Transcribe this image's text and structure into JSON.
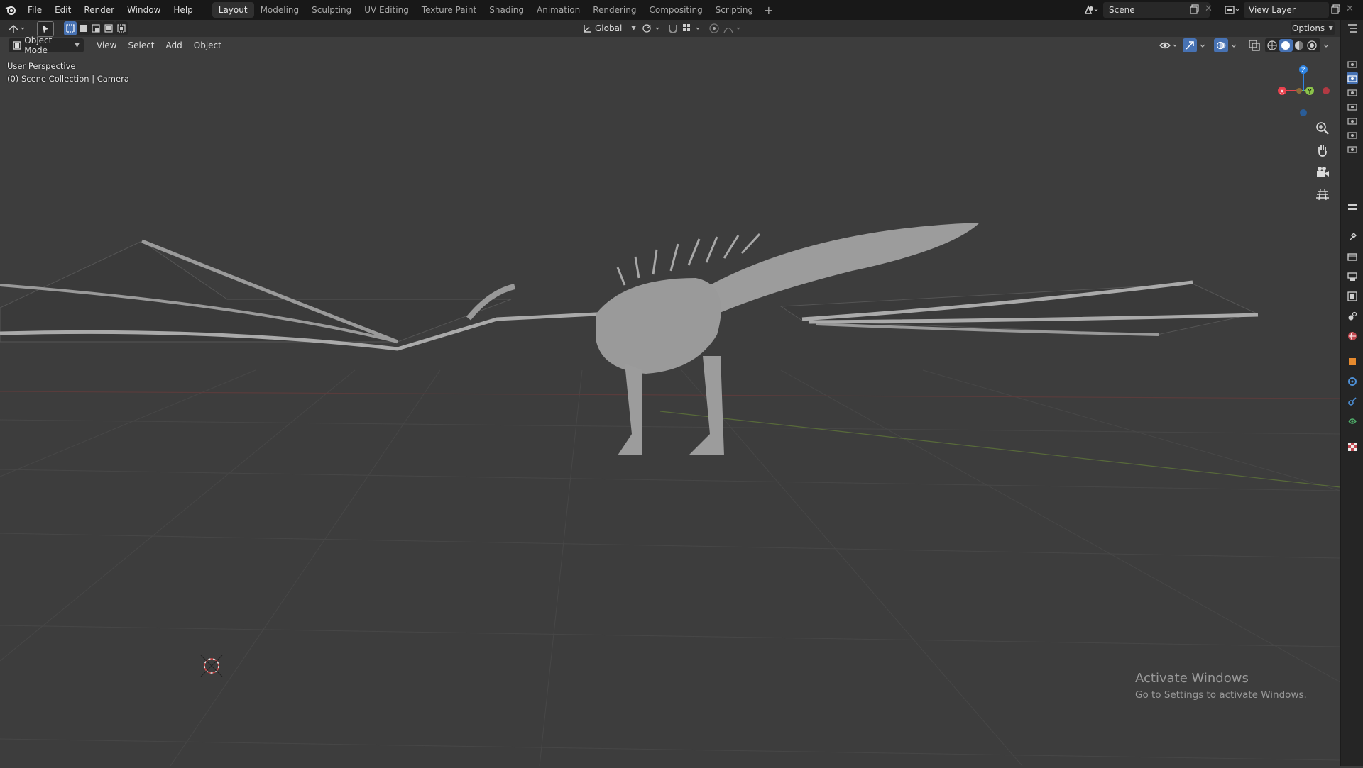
{
  "topbar": {
    "menus": [
      "File",
      "Edit",
      "Render",
      "Window",
      "Help"
    ],
    "workspace_tabs": [
      "Layout",
      "Modeling",
      "Sculpting",
      "UV Editing",
      "Texture Paint",
      "Shading",
      "Animation",
      "Rendering",
      "Compositing",
      "Scripting"
    ],
    "active_tab": "Layout",
    "add_workspace": "+",
    "scene_name": "Scene",
    "view_layer_name": "View Layer"
  },
  "toolheader": {
    "transform_orientation": "Global",
    "options_label": "Options"
  },
  "viewheader": {
    "mode": "Object Mode",
    "menus": [
      "View",
      "Select",
      "Add",
      "Object"
    ]
  },
  "viewport": {
    "perspective_label": "User Perspective",
    "collection_label": "(0) Scene Collection | Camera",
    "gizmo_axes": {
      "x": "X",
      "y": "Y",
      "z": "Z"
    },
    "colors": {
      "background": "#3d3d3d",
      "grid": "#474747",
      "x_axis": "#e8424e",
      "y_axis": "#8bc34a",
      "z_axis": "#2f84e3",
      "model": "#9a9a9a"
    }
  },
  "watermark": {
    "title": "Activate Windows",
    "subtitle": "Go to Settings to activate Windows."
  },
  "icons": {
    "blender_logo": "blender-logo-icon",
    "cursor": "3d-cursor-icon",
    "zoom": "zoom-icon",
    "pan": "hand-icon",
    "camera": "camera-view-icon",
    "ortho": "grid-toggle-icon"
  }
}
